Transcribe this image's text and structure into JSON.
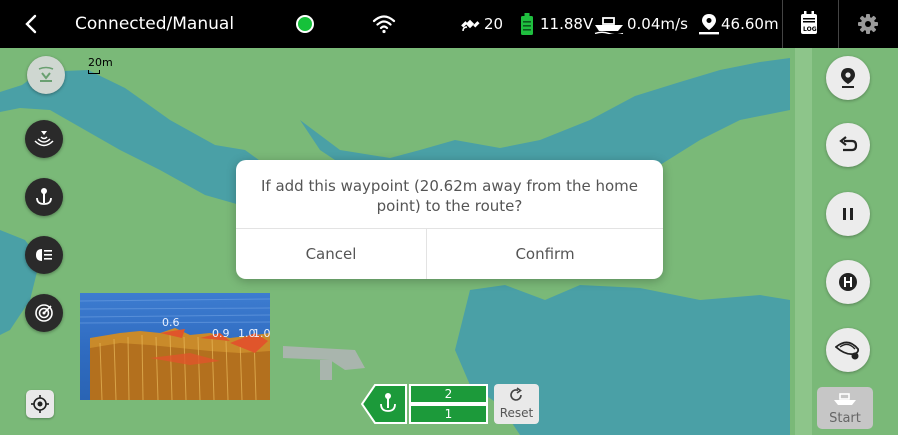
{
  "status_bar": {
    "back_icon": "chevron-left-icon",
    "connection_label": "Connected/Manual",
    "status_dot_color": "#16c13a",
    "wifi_icon": "wifi-icon",
    "satellite_count": "20",
    "voltage": "11.88V",
    "speed": "0.04m/s",
    "distance": "46.60m",
    "log_label": "LOG",
    "settings_icon": "gear-icon"
  },
  "map": {
    "scale_label": "20m",
    "land_color": "#7ab978",
    "water_color": "#4aa0a6"
  },
  "left_tools": [
    "collapse-icon",
    "sonar-cast-icon",
    "anchor-icon",
    "headlight-icon",
    "radar-icon",
    "locate-icon"
  ],
  "right_tools": [
    "waypoint-pin-icon",
    "return-icon",
    "pause-icon",
    "home-icon",
    "nest-icon"
  ],
  "dialog": {
    "message": "If add this waypoint (20.62m away from the home point) to the route?",
    "cancel": "Cancel",
    "confirm": "Confirm"
  },
  "sonar": {
    "depth_labels": [
      "0.6",
      "0.9",
      "1.0",
      "1.0"
    ]
  },
  "bottom": {
    "route_points": [
      "2",
      "1"
    ],
    "reset_label": "Reset",
    "start_label": "Start"
  }
}
